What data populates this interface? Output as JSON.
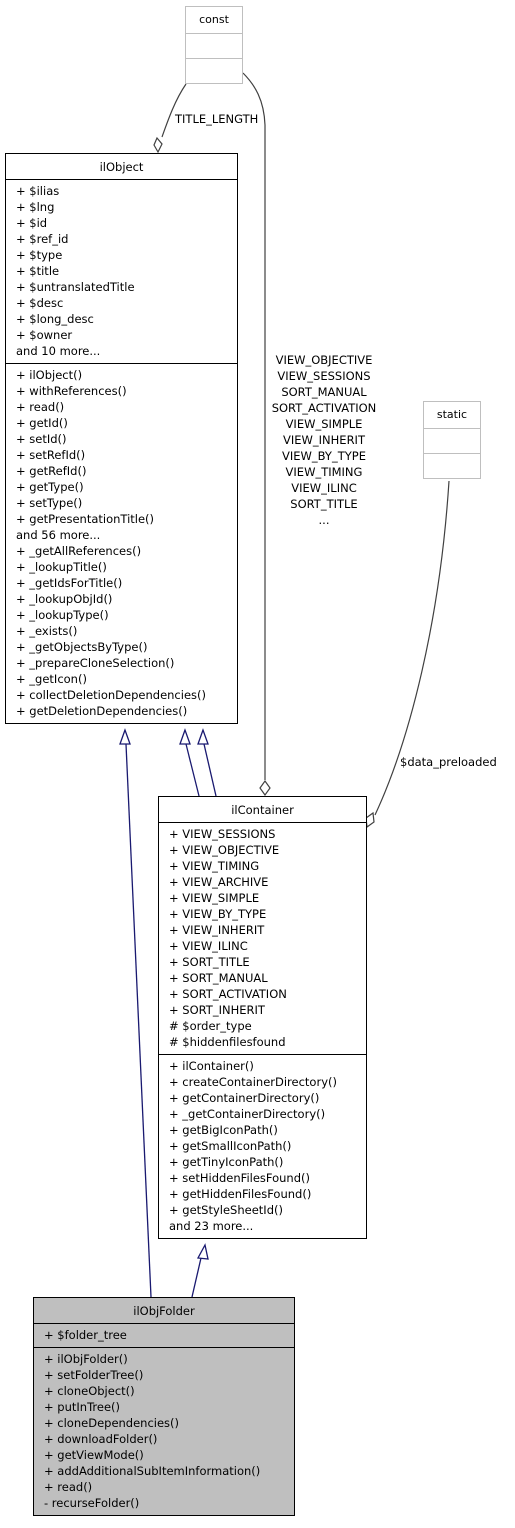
{
  "diagram": {
    "type": "uml-collaboration",
    "focus_class": "ilObjFolder",
    "colors": {
      "inheritance": "#191970",
      "association": "#404040",
      "focus_fill": "#bfbfbf",
      "ghost_border": "#bfbfbf"
    }
  },
  "classes": {
    "const": {
      "name": "const"
    },
    "static": {
      "name": "static"
    },
    "ilObject": {
      "name": "ilObject",
      "attributes": [
        "+ $ilias",
        "+ $lng",
        "+ $id",
        "+ $ref_id",
        "+ $type",
        "+ $title",
        "+ $untranslatedTitle",
        "+ $desc",
        "+ $long_desc",
        "+ $owner",
        "and 10 more..."
      ],
      "methods": [
        "+ ilObject()",
        "+ withReferences()",
        "+ read()",
        "+ getId()",
        "+ setId()",
        "+ setRefId()",
        "+ getRefId()",
        "+ getType()",
        "+ setType()",
        "+ getPresentationTitle()",
        "and 56 more...",
        "+ _getAllReferences()",
        "+ _lookupTitle()",
        "+ _getIdsForTitle()",
        "+ _lookupObjId()",
        "+ _lookupType()",
        "+ _exists()",
        "+ _getObjectsByType()",
        "+ _prepareCloneSelection()",
        "+ _getIcon()",
        "+ collectDeletionDependencies()",
        "+ getDeletionDependencies()"
      ]
    },
    "ilContainer": {
      "name": "ilContainer",
      "attributes": [
        "+ VIEW_SESSIONS",
        "+ VIEW_OBJECTIVE",
        "+ VIEW_TIMING",
        "+ VIEW_ARCHIVE",
        "+ VIEW_SIMPLE",
        "+ VIEW_BY_TYPE",
        "+ VIEW_INHERIT",
        "+ VIEW_ILINC",
        "+ SORT_TITLE",
        "+ SORT_MANUAL",
        "+ SORT_ACTIVATION",
        "+ SORT_INHERIT",
        "# $order_type",
        "# $hiddenfilesfound"
      ],
      "methods": [
        "+ ilContainer()",
        "+ createContainerDirectory()",
        "+ getContainerDirectory()",
        "+ _getContainerDirectory()",
        "+ getBigIconPath()",
        "+ getSmallIconPath()",
        "+ getTinyIconPath()",
        "+ setHiddenFilesFound()",
        "+ getHiddenFilesFound()",
        "+ getStyleSheetId()",
        "and 23 more..."
      ]
    },
    "ilObjFolder": {
      "name": "ilObjFolder",
      "attributes": [
        "+ $folder_tree"
      ],
      "methods": [
        "+ ilObjFolder()",
        "+ setFolderTree()",
        "+ cloneObject()",
        "+ putInTree()",
        "+ cloneDependencies()",
        "+ downloadFolder()",
        "+ getViewMode()",
        "+ addAdditionalSubItemInformation()",
        "+ read()",
        "- recurseFolder()"
      ]
    }
  },
  "edge_labels": {
    "title_length": "TITLE_LENGTH",
    "container_consts": [
      "VIEW_OBJECTIVE",
      "VIEW_SESSIONS",
      "SORT_MANUAL",
      "SORT_ACTIVATION",
      "VIEW_SIMPLE",
      "VIEW_INHERIT",
      "VIEW_BY_TYPE",
      "VIEW_TIMING",
      "VIEW_ILINC",
      "SORT_TITLE",
      "..."
    ],
    "data_preloaded": "$data_preloaded"
  }
}
